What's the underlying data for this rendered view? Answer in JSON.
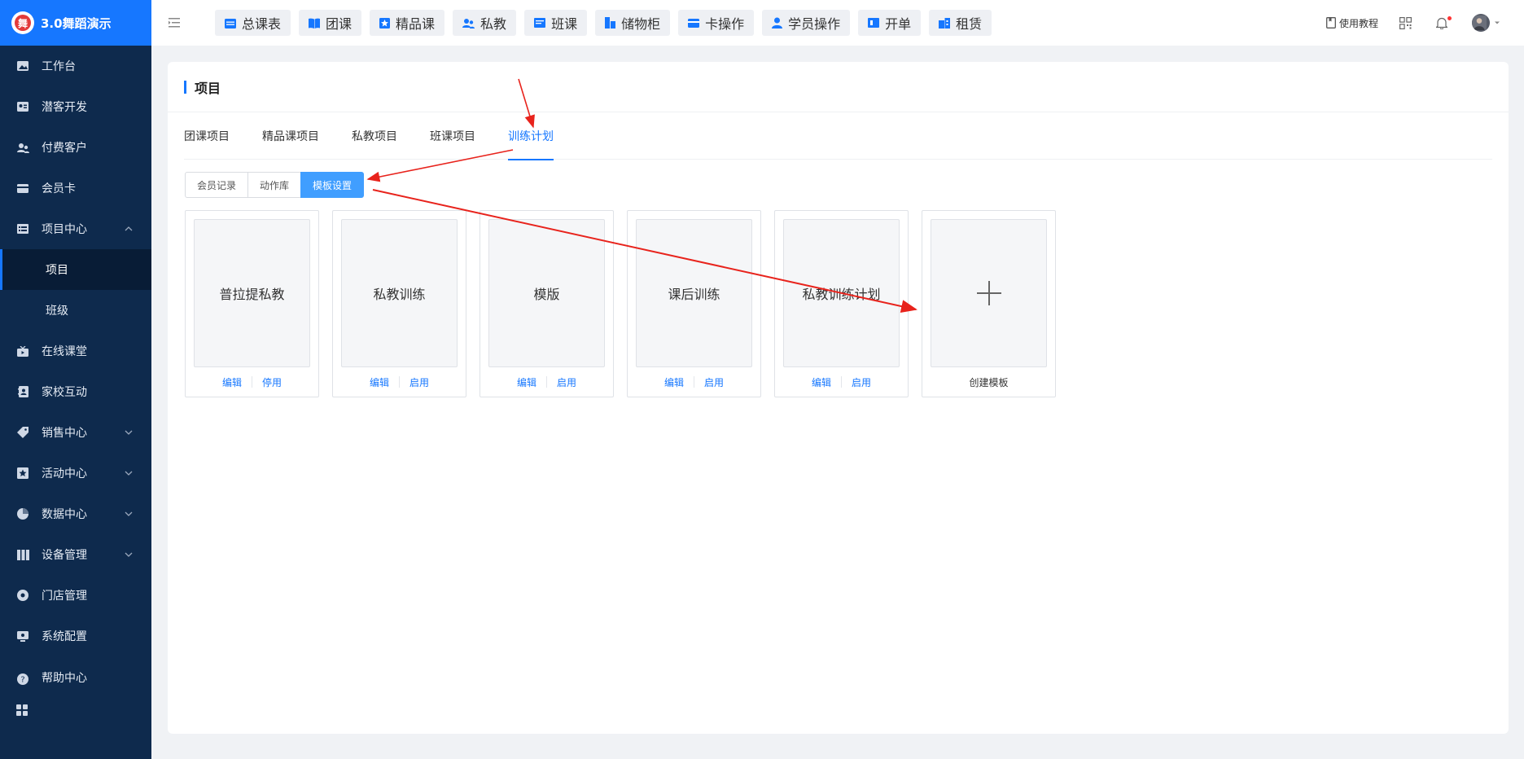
{
  "brand": {
    "name": "3.0舞蹈演示"
  },
  "sidebar": {
    "items": [
      {
        "label": "工作台",
        "icon": "image-icon"
      },
      {
        "label": "潜客开发",
        "icon": "id-card-icon"
      },
      {
        "label": "付费客户",
        "icon": "users-icon"
      },
      {
        "label": "会员卡",
        "icon": "card-icon"
      },
      {
        "label": "项目中心",
        "icon": "list-icon",
        "expanded": true,
        "children": [
          {
            "label": "项目",
            "active": true
          },
          {
            "label": "班级"
          }
        ]
      },
      {
        "label": "在线课堂",
        "icon": "tv-icon"
      },
      {
        "label": "家校互动",
        "icon": "contact-icon"
      },
      {
        "label": "销售中心",
        "icon": "tag-icon"
      },
      {
        "label": "活动中心",
        "icon": "badge-icon"
      },
      {
        "label": "数据中心",
        "icon": "pie-chart-icon"
      },
      {
        "label": "设备管理",
        "icon": "columns-icon"
      },
      {
        "label": "门店管理",
        "icon": "target-icon"
      },
      {
        "label": "系统配置",
        "icon": "monitor-icon"
      },
      {
        "label": "帮助中心",
        "icon": "help-icon"
      }
    ]
  },
  "topnav": {
    "buttons": [
      {
        "label": "总课表",
        "icon": "calendar-icon"
      },
      {
        "label": "团课",
        "icon": "book-icon"
      },
      {
        "label": "精品课",
        "icon": "star-icon"
      },
      {
        "label": "私教",
        "icon": "users-icon"
      },
      {
        "label": "班课",
        "icon": "board-icon"
      },
      {
        "label": "储物柜",
        "icon": "locker-icon"
      },
      {
        "label": "卡操作",
        "icon": "card-icon"
      },
      {
        "label": "学员操作",
        "icon": "user-icon"
      },
      {
        "label": "开单",
        "icon": "receipt-icon"
      },
      {
        "label": "租赁",
        "icon": "building-icon"
      }
    ],
    "right": {
      "tutorial": "使用教程"
    }
  },
  "page": {
    "title": "项目",
    "tabs": [
      "团课项目",
      "精品课项目",
      "私教项目",
      "班课项目",
      "训练计划"
    ],
    "active_tab": "训练计划",
    "segments": [
      "会员记录",
      "动作库",
      "模板设置"
    ],
    "active_segment": "模板设置",
    "templates": [
      {
        "name": "普拉提私教",
        "edit": "编辑",
        "toggle": "停用"
      },
      {
        "name": "私教训练",
        "edit": "编辑",
        "toggle": "启用"
      },
      {
        "name": "模版",
        "edit": "编辑",
        "toggle": "启用"
      },
      {
        "name": "课后训练",
        "edit": "编辑",
        "toggle": "启用"
      },
      {
        "name": "私教训练计划",
        "edit": "编辑",
        "toggle": "启用"
      }
    ],
    "create_label": "创建模板"
  },
  "colors": {
    "primary": "#1677ff",
    "sidebar": "#0e2a4d",
    "annotation": "#e8231c"
  }
}
